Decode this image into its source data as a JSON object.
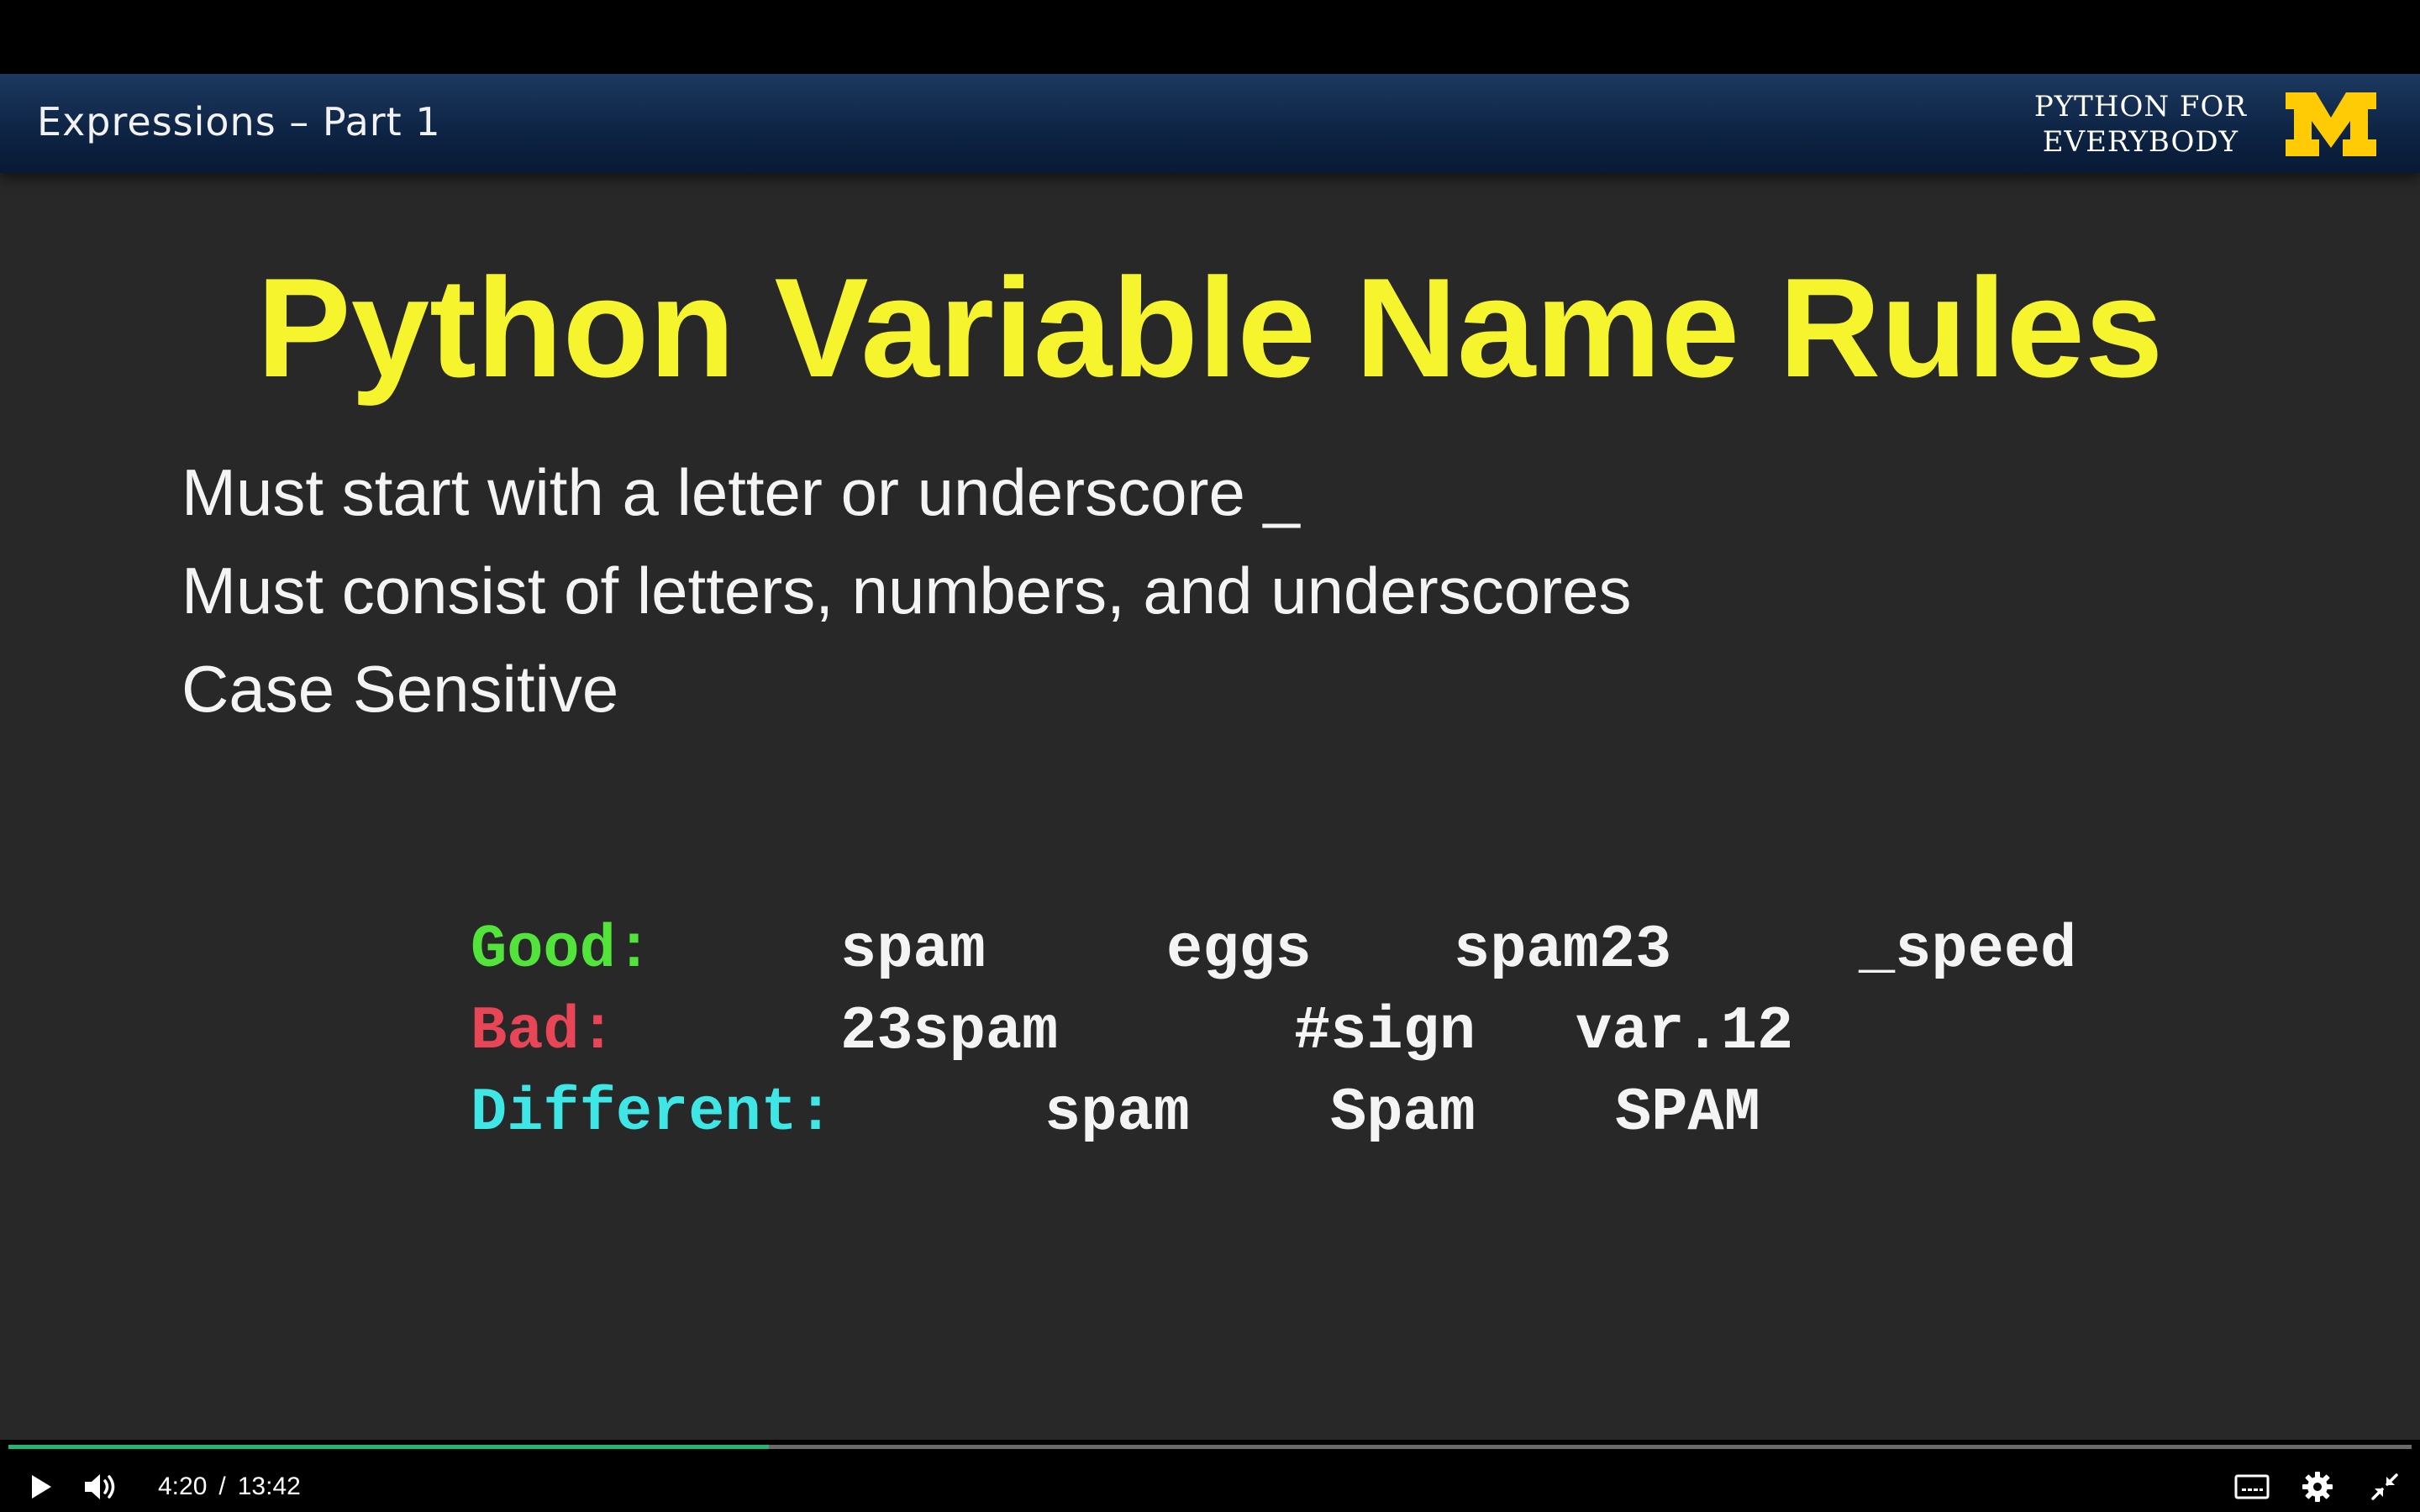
{
  "header": {
    "lecture_title": "Expressions – Part 1",
    "brand_line1": "PYTHON FOR",
    "brand_line2": "EVERYBODY",
    "logo_icon": "university-of-michigan-block-m-logo"
  },
  "slide": {
    "title": "Python Variable Name Rules",
    "rules": [
      "Must start with a letter or underscore _",
      "Must consist of letters, numbers, and underscores",
      "Case Sensitive"
    ],
    "examples": {
      "good": {
        "label": "Good:",
        "items": [
          "spam",
          "eggs",
          "spam23",
          "_speed"
        ]
      },
      "bad": {
        "label": "Bad:",
        "items": [
          "23spam",
          "#sign",
          "var.12"
        ]
      },
      "different": {
        "label": "Different:",
        "items": [
          "spam",
          "Spam",
          "SPAM"
        ]
      }
    }
  },
  "player": {
    "current_time": "4:20",
    "separator": "/",
    "duration": "13:42",
    "progress_fraction": 0.3163,
    "colors": {
      "progress": "#22b573",
      "title_yellow": "#f5f42d",
      "good_green": "#52e43a",
      "bad_red": "#e84556",
      "different_cyan": "#3fe6e6"
    },
    "icons": [
      "play-icon",
      "volume-icon",
      "captions-icon",
      "settings-icon",
      "exit-fullscreen-icon"
    ]
  }
}
